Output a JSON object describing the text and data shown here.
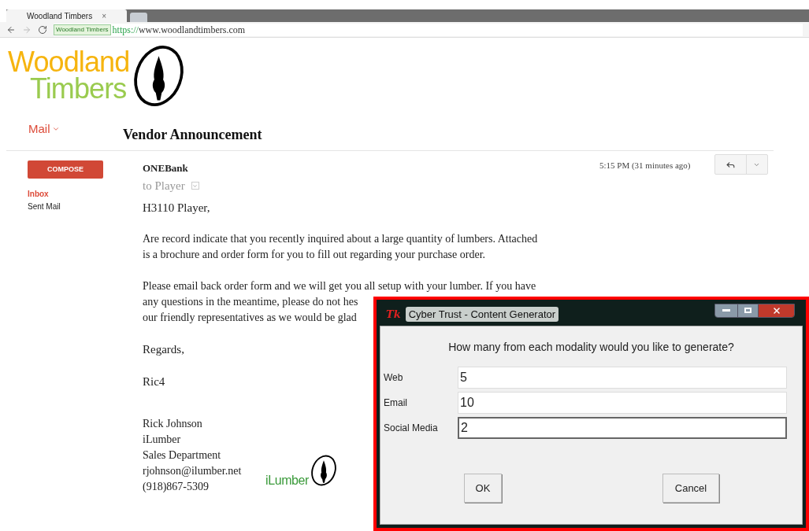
{
  "browser": {
    "tab": {
      "title": "Woodland Timbers",
      "close": "×"
    },
    "address": {
      "site_badge": "Woodland Timbers",
      "scheme": "https://",
      "host": "www.woodlandtimbers.com"
    }
  },
  "logo": {
    "line1": "Woodland",
    "line2": "Timbers"
  },
  "mail": {
    "menu": "Mail",
    "compose": "COMPOSE",
    "folders": [
      {
        "label": "Inbox",
        "selected": true
      },
      {
        "label": "Sent Mail",
        "selected": false
      }
    ]
  },
  "message": {
    "subject": "Vendor Announcement",
    "sender": "ONEBank",
    "recipient": "to Player",
    "time": "5:15 PM (31 minutes ago)",
    "greeting": "H3110 Player,",
    "paragraphs": [
      [
        "Are record indicate that you recently inquired about a large quantity of lumbers. Attached",
        "is a brochure and order form for you to fill out regarding your purchase order."
      ],
      [
        "Please email back order form and we will get you all setup with your lumber. If you have",
        "any questions in the meantime, please do not hes",
        "our friendly representatives as we would be glad"
      ]
    ],
    "closing": "Regards,",
    "signoff": "Ric4",
    "signature": [
      "Rick Johnson",
      "iLumber",
      "Sales Department",
      "rjohnson@ilumber.net",
      "(918)867-5309"
    ],
    "signature_logo": "iLumber"
  },
  "dialog": {
    "title": "Cyber Trust - Content Generator",
    "app_icon": "Tk",
    "question": "How many from each modality would you like to generate?",
    "fields": [
      {
        "label": "Web",
        "value": "5",
        "focused": false
      },
      {
        "label": "Email",
        "value": "10",
        "focused": false
      },
      {
        "label": "Social Media",
        "value": "2",
        "focused": true
      }
    ],
    "buttons": [
      "OK",
      "Cancel"
    ]
  }
}
